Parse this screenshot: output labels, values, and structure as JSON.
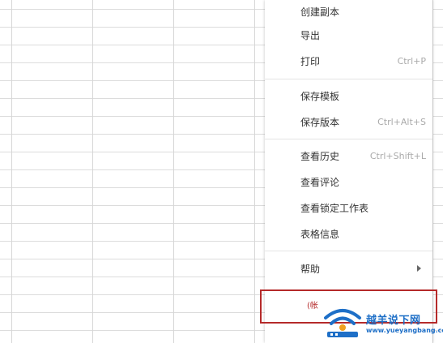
{
  "menu": {
    "items": [
      {
        "label": "创建副本",
        "shortcut": ""
      },
      {
        "label": "导出",
        "shortcut": ""
      },
      {
        "label": "打印",
        "shortcut": "Ctrl+P"
      },
      {
        "label": "保存模板",
        "shortcut": ""
      },
      {
        "label": "保存版本",
        "shortcut": "Ctrl+Alt+S"
      },
      {
        "label": "查看历史",
        "shortcut": "Ctrl+Shift+L"
      },
      {
        "label": "查看评论",
        "shortcut": ""
      },
      {
        "label": "查看锁定工作表",
        "shortcut": ""
      },
      {
        "label": "表格信息",
        "shortcut": ""
      },
      {
        "label": "帮助",
        "shortcut": ""
      }
    ],
    "highlight_label": "(帐"
  },
  "watermark": {
    "brand": "越羊说下网",
    "url": "www.yueyangbang.com"
  },
  "colors": {
    "highlight": "#b52a2a",
    "brand": "#1e6fc7"
  }
}
